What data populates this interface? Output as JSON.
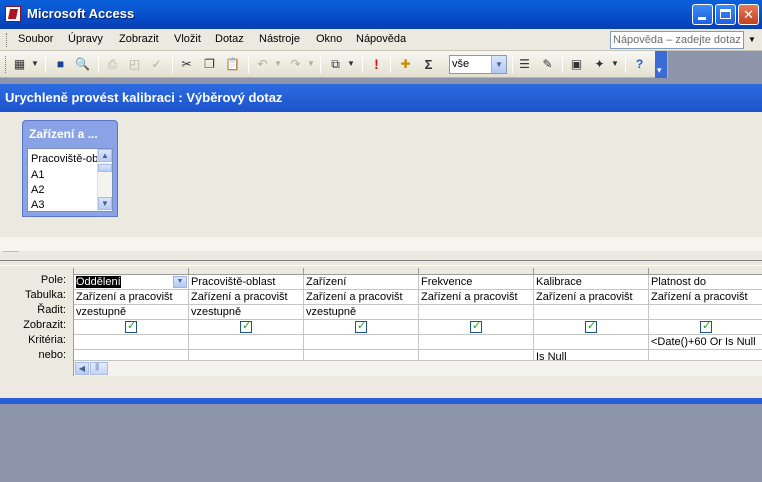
{
  "window": {
    "title": "Microsoft Access"
  },
  "menu": {
    "items": [
      "Soubor",
      "Úpravy",
      "Zobrazit",
      "Vložit",
      "Dotaz",
      "Nástroje",
      "Okno",
      "Nápověda"
    ],
    "help_placeholder": "Nápověda – zadejte dotaz"
  },
  "toolbar": {
    "top_values": "vše",
    "totals_symbol": "Σ",
    "run_symbol": "!"
  },
  "query": {
    "title": "Urychleně provést kalibraci : Výběrový dotaz",
    "field_list": {
      "title": "Zařízení a ...",
      "items": [
        "Pracoviště-ob",
        "A1",
        "A2",
        "A3"
      ]
    }
  },
  "grid": {
    "row_labels": [
      "Pole:",
      "Tabulka:",
      "Řadit:",
      "Zobrazit:",
      "Kritéria:",
      "nebo:"
    ],
    "columns": [
      {
        "field": "Oddělení",
        "table": "Zařízení a pracovišt",
        "sort": "vzestupně",
        "show": true,
        "criteria": "",
        "or": ""
      },
      {
        "field": "Pracoviště-oblast",
        "table": "Zařízení a pracovišt",
        "sort": "vzestupně",
        "show": true,
        "criteria": "",
        "or": ""
      },
      {
        "field": "Zařízení",
        "table": "Zařízení a pracovišt",
        "sort": "vzestupně",
        "show": true,
        "criteria": "",
        "or": ""
      },
      {
        "field": "Frekvence",
        "table": "Zařízení a pracovišt",
        "sort": "",
        "show": true,
        "criteria": "",
        "or": ""
      },
      {
        "field": "Kalibrace",
        "table": "Zařízení a pracovišt",
        "sort": "",
        "show": true,
        "criteria": "",
        "or": "Is Null"
      },
      {
        "field": "Platnost do",
        "table": "Zařízení a pracovišt",
        "sort": "",
        "show": true,
        "criteria": "<Date()+60 Or Is Null",
        "or": ""
      }
    ]
  }
}
